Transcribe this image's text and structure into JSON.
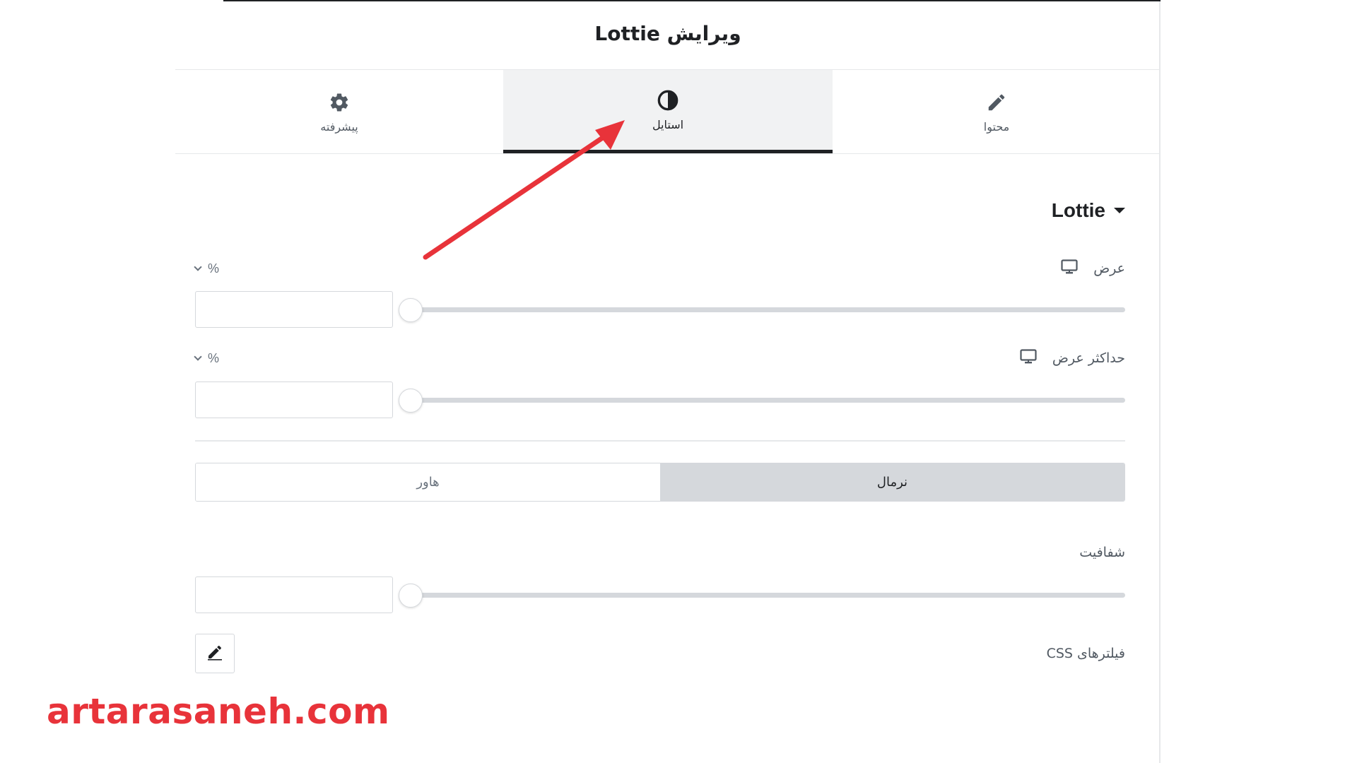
{
  "header": {
    "title": "ویرایش Lottie"
  },
  "tabs": [
    {
      "label": "پیشرفته",
      "icon": "gear-icon"
    },
    {
      "label": "استایل",
      "icon": "contrast-icon",
      "active": true
    },
    {
      "label": "محتوا",
      "icon": "pencil-icon"
    }
  ],
  "section": {
    "title": "Lottie"
  },
  "controls": {
    "width": {
      "label": "عرض",
      "unit": "%",
      "value": 0
    },
    "max_width": {
      "label": "حداکثر عرض",
      "unit": "%",
      "value": 0
    },
    "opacity": {
      "label": "شفافیت",
      "value": 0
    }
  },
  "state_tabs": {
    "normal": "نرمال",
    "hover": "هاور"
  },
  "filters": {
    "label": "فیلترهای CSS"
  },
  "watermark": "artarasaneh.com",
  "colors": {
    "accent_arrow": "#e8333a",
    "active_tab_bg": "#f1f2f3",
    "text": "#1f2124"
  }
}
